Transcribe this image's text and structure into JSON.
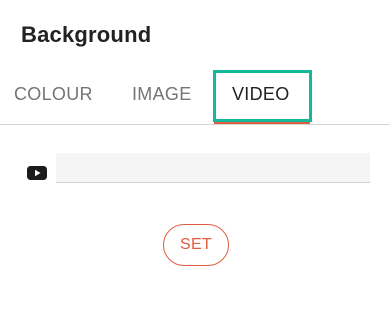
{
  "panel": {
    "title": "Background"
  },
  "tabs": [
    {
      "label": "COLOUR",
      "active": false
    },
    {
      "label": "IMAGE",
      "active": false
    },
    {
      "label": "VIDEO",
      "active": true
    }
  ],
  "video": {
    "icon": "youtube-icon",
    "input_value": "",
    "input_placeholder": ""
  },
  "actions": {
    "set_label": "SET"
  },
  "colors": {
    "accent": "#e05c40",
    "highlight": "#14b89b",
    "title_text": "#222222",
    "tab_text": "#757575"
  }
}
